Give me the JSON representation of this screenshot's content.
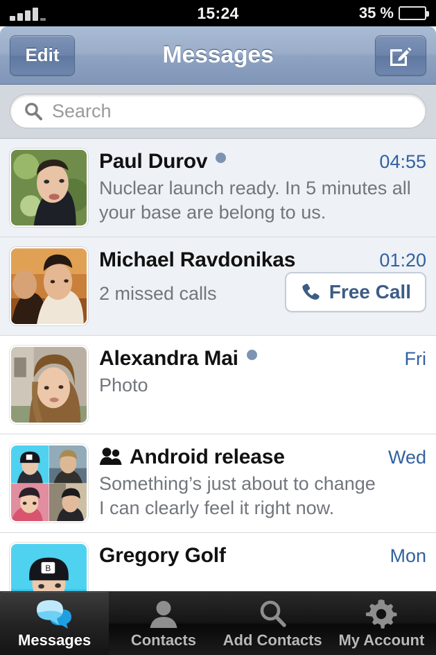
{
  "status_bar": {
    "signal_icon": "signal-bars-icon",
    "signal_bars": 4,
    "time": "15:24",
    "battery_percent_label": "35 %",
    "battery_level": 35,
    "battery_icon": "battery-icon"
  },
  "nav_bar": {
    "edit_label": "Edit",
    "title": "Messages",
    "compose_icon": "compose-icon"
  },
  "search": {
    "icon": "search-icon",
    "placeholder": "Search",
    "value": ""
  },
  "chats": [
    {
      "name": "Paul Durov",
      "time": "04:55",
      "unread": true,
      "unread_dot": "unread-dot",
      "preview_lines": [
        "Nuclear launch ready. In 5 minutes all",
        "your base are belong to us."
      ],
      "avatar": "avatar-paul-durov",
      "is_group": false
    },
    {
      "name": "Michael Ravdonikas",
      "time": "01:20",
      "unread": true,
      "preview_lines": [
        "2 missed calls"
      ],
      "avatar": "avatar-michael-ravdonikas",
      "is_group": false,
      "action_button": {
        "label": "Free Call",
        "icon": "phone-icon"
      }
    },
    {
      "name": "Alexandra Mai",
      "time": "Fri",
      "unread": true,
      "unread_dot": "unread-dot",
      "preview_lines": [
        "Photo"
      ],
      "avatar": "avatar-alexandra-mai",
      "is_group": false
    },
    {
      "name": "Android release",
      "time": "Wed",
      "unread": false,
      "group_icon": "group-people-icon",
      "preview_lines": [
        "Something’s just about to change",
        "I can clearly feel it right now."
      ],
      "avatar": "avatar-group-android-release",
      "is_group": true
    },
    {
      "name": "Gregory Golf",
      "time": "Mon",
      "unread": false,
      "preview_lines": [],
      "avatar": "avatar-gregory-golf",
      "is_group": false
    }
  ],
  "tab_bar": {
    "items": [
      {
        "label": "Messages",
        "icon": "chat-bubbles-icon",
        "active": true
      },
      {
        "label": "Contacts",
        "icon": "person-icon",
        "active": false
      },
      {
        "label": "Add Contacts",
        "icon": "magnifier-icon",
        "active": false
      },
      {
        "label": "My Account",
        "icon": "gear-icon",
        "active": false
      }
    ]
  },
  "colors": {
    "accent_blue": "#31619f",
    "nav_bar_blue": "#95a9c6",
    "unread_row": "#eef1f5",
    "unread_dot": "#7d93b3",
    "tab_active_blue": "#2ea8e6"
  }
}
